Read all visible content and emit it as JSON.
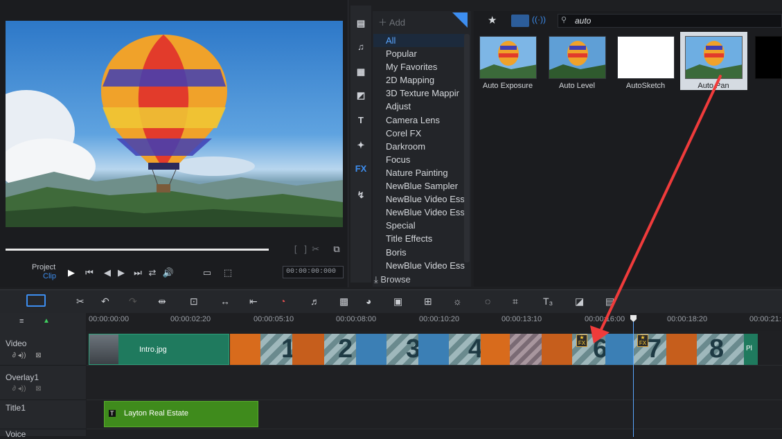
{
  "player": {
    "project_label": "Project",
    "clip_label": "Clip",
    "timecode": "00:00:00:000"
  },
  "library": {
    "add_label": "Add",
    "search_value": "auto",
    "browse_label": "Browse",
    "categories": [
      "All",
      "Popular",
      "My Favorites",
      "2D Mapping",
      "3D Texture Mappir",
      "Adjust",
      "Camera Lens",
      "Corel FX",
      "Darkroom",
      "Focus",
      "Nature Painting",
      "NewBlue Sampler",
      "NewBlue Video Ess",
      "NewBlue Video Ess",
      "Special",
      "Title Effects",
      "Boris",
      "NewBlue Video Ess"
    ],
    "filters": [
      "Auto Exposure",
      "Auto Level",
      "AutoSketch",
      "Auto Pan"
    ],
    "selected_filter": "Auto Pan"
  },
  "timeline": {
    "ruler": [
      "00:00:00:00",
      "00:00:02:20",
      "00:00:05:10",
      "00:00:08:00",
      "00:00:10:20",
      "00:00:13:10",
      "00:00:16:00",
      "00:00:18:20",
      "00:00:21:"
    ],
    "tracks": {
      "video": "Video",
      "overlay": "Overlay1",
      "title": "Title1",
      "voice": "Voice"
    },
    "clips": {
      "intro": "Intro.jpg",
      "title_clip": "Layton Real Estate",
      "last": "Pl"
    },
    "transition_numbers": [
      "1",
      "2",
      "3",
      "4",
      "6",
      "7",
      "8"
    ]
  },
  "colors": {
    "accent": "#3d8ef0",
    "annotation_arrow": "#ef3b3b",
    "title_clip": "#3f8b1c",
    "video_clip": "#1f7a5e"
  }
}
